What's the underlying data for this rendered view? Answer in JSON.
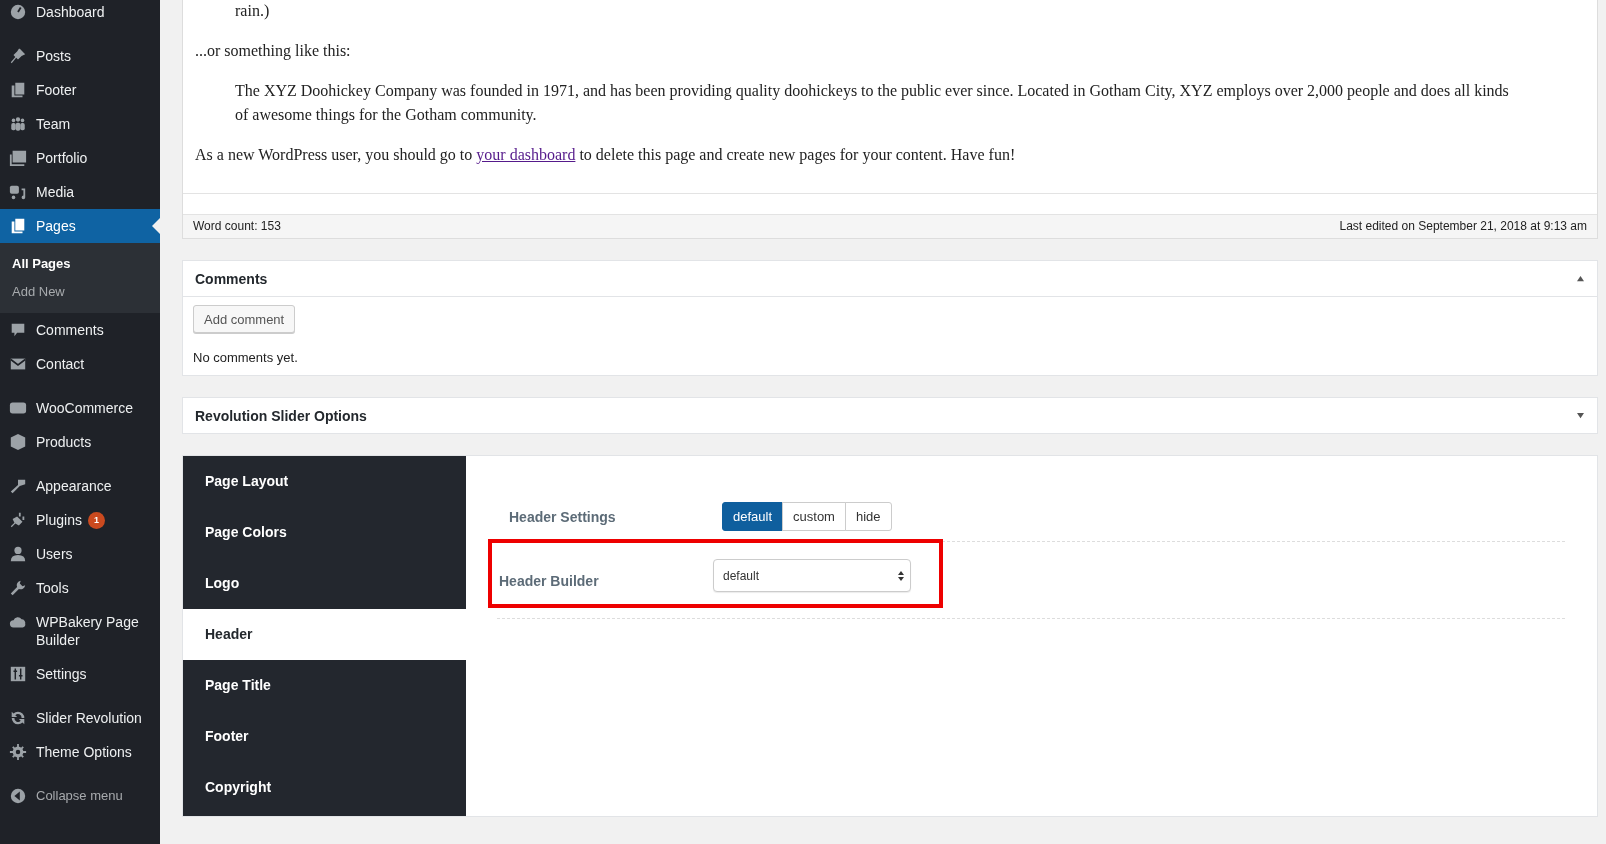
{
  "sidebar": {
    "groups": [
      {
        "items": [
          {
            "label": "Dashboard",
            "selected": false
          }
        ]
      },
      {
        "items": [
          {
            "label": "Posts",
            "selected": false
          },
          {
            "label": "Footer",
            "selected": false
          },
          {
            "label": "Team",
            "selected": false
          },
          {
            "label": "Portfolio",
            "selected": false
          },
          {
            "label": "Media",
            "selected": false
          },
          {
            "label": "Pages",
            "selected": true,
            "children": [
              {
                "label": "All Pages",
                "selected": true
              },
              {
                "label": "Add New",
                "selected": false
              }
            ]
          },
          {
            "label": "Comments",
            "selected": false
          },
          {
            "label": "Contact",
            "selected": false
          }
        ]
      },
      {
        "items": [
          {
            "label": "WooCommerce",
            "selected": false
          },
          {
            "label": "Products",
            "selected": false
          }
        ]
      },
      {
        "items": [
          {
            "label": "Appearance",
            "selected": false
          },
          {
            "label": "Plugins",
            "selected": false,
            "badge": "1"
          },
          {
            "label": "Users",
            "selected": false
          },
          {
            "label": "Tools",
            "selected": false
          },
          {
            "label": "WPBakery Page Builder",
            "selected": false
          },
          {
            "label": "Settings",
            "selected": false
          }
        ]
      },
      {
        "items": [
          {
            "label": "Slider Revolution",
            "selected": false
          },
          {
            "label": "Theme Options",
            "selected": false
          }
        ]
      }
    ],
    "collapse": "Collapse menu"
  },
  "content": {
    "paragraphs": [
      {
        "kind": "quote",
        "text": "rain.)"
      },
      {
        "kind": "plain",
        "text": "...or something like this:"
      },
      {
        "kind": "quote",
        "text": "The XYZ Doohickey Company was founded in 1971, and has been providing quality doohickeys to the public ever since. Located in Gotham City, XYZ employs over 2,000 people and does all kinds of awesome things for the Gotham community."
      },
      {
        "kind": "link",
        "before": "As a new WordPress user, you should go to ",
        "link": "your dashboard",
        "after": " to delete this page and create new pages for your content. Have fun!"
      }
    ],
    "word_count": "Word count: 153",
    "last_edited": "Last edited on September 21, 2018 at 9:13 am"
  },
  "comments": {
    "title": "Comments",
    "expanded": true,
    "button": "Add comment",
    "empty": "No comments yet."
  },
  "revolution": {
    "title": "Revolution Slider Options",
    "expanded": false
  },
  "options": {
    "tabs": [
      {
        "label": "Page Layout",
        "selected": false
      },
      {
        "label": "Page Colors",
        "selected": false
      },
      {
        "label": "Logo",
        "selected": false
      },
      {
        "label": "Header",
        "selected": true
      },
      {
        "label": "Page Title",
        "selected": false
      },
      {
        "label": "Footer",
        "selected": false
      },
      {
        "label": "Copyright",
        "selected": false
      }
    ],
    "header_settings": {
      "label": "Header Settings",
      "choices": [
        {
          "label": "default",
          "selected": true
        },
        {
          "label": "custom",
          "selected": false
        },
        {
          "label": "hide",
          "selected": false
        }
      ]
    },
    "header_builder": {
      "label": "Header Builder",
      "value": "default",
      "highlighted": true
    }
  }
}
